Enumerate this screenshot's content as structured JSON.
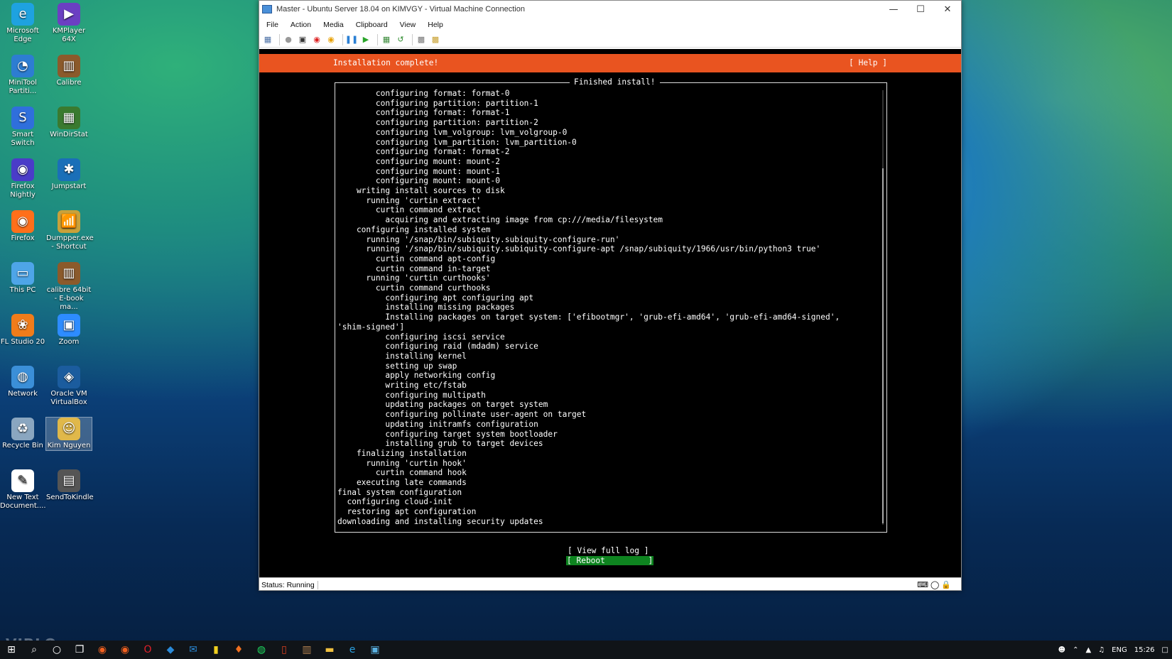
{
  "desktop": {
    "icons": [
      {
        "label": "Microsoft Edge",
        "icon": "edge-icon",
        "color": "#1ea2e0"
      },
      {
        "label": "KMPlayer 64X",
        "icon": "kmplayer-icon",
        "color": "#6b3fc2"
      },
      {
        "label": "MiniTool Partiti...",
        "icon": "minitool-icon",
        "color": "#2d7dd2"
      },
      {
        "label": "Calibre",
        "icon": "calibre-icon",
        "color": "#8b5a2b"
      },
      {
        "label": "Smart Switch",
        "icon": "smartswitch-icon",
        "color": "#2f6fdc"
      },
      {
        "label": "WinDirStat",
        "icon": "windirstat-icon",
        "color": "#3a7a2f"
      },
      {
        "label": "Firefox Nightly",
        "icon": "firefox-nightly-icon",
        "color": "#4a3cc8"
      },
      {
        "label": "Jumpstart",
        "icon": "jumpstart-icon",
        "color": "#1a6fb8"
      },
      {
        "label": "Firefox",
        "icon": "firefox-icon",
        "color": "#ff6f1a"
      },
      {
        "label": "Dumpper.exe - Shortcut",
        "icon": "dumpper-icon",
        "color": "#c9a13a"
      },
      {
        "label": "This PC",
        "icon": "this-pc-icon",
        "color": "#4ea5e8"
      },
      {
        "label": "calibre 64bit - E-book ma...",
        "icon": "calibre64-icon",
        "color": "#8b5a2b"
      },
      {
        "label": "FL Studio 20",
        "icon": "flstudio-icon",
        "color": "#f07c1a"
      },
      {
        "label": "Zoom",
        "icon": "zoom-icon",
        "color": "#2d8cff"
      },
      {
        "label": "Network",
        "icon": "network-icon",
        "color": "#3b8fd8"
      },
      {
        "label": "Oracle VM VirtualBox",
        "icon": "virtualbox-icon",
        "color": "#1b5c9e"
      },
      {
        "label": "Recycle Bin",
        "icon": "recycle-bin-icon",
        "color": "#8aa6c0"
      },
      {
        "label": "Kim Nguyen",
        "icon": "user-folder-icon",
        "color": "#e0b84a"
      },
      {
        "label": "New Text Document....",
        "icon": "text-doc-icon",
        "color": "#ffffff"
      },
      {
        "label": "SendToKindle",
        "icon": "kindle-icon",
        "color": "#555555"
      }
    ],
    "watermark": "VIBLO"
  },
  "window": {
    "title": "Master - Ubuntu Server 18.04 on KIMVGY - Virtual Machine Connection",
    "menu": [
      "File",
      "Action",
      "Media",
      "Clipboard",
      "View",
      "Help"
    ],
    "toolbar_icons": [
      "ctrl-alt-del-icon",
      "start-icon",
      "turnoff-icon",
      "shutdown-icon",
      "save-icon",
      "pause-icon",
      "resume-icon",
      "checkpoint-icon",
      "revert-icon",
      "enhanced-session-icon",
      "share-icon"
    ],
    "status": "Status: Running"
  },
  "installer": {
    "banner": "Installation complete!",
    "help": "[ Help ]",
    "box_title": "Finished install!",
    "log": [
      "        configuring format: format-0",
      "        configuring partition: partition-1",
      "        configuring format: format-1",
      "        configuring partition: partition-2",
      "        configuring lvm_volgroup: lvm_volgroup-0",
      "        configuring lvm_partition: lvm_partition-0",
      "        configuring format: format-2",
      "        configuring mount: mount-2",
      "        configuring mount: mount-1",
      "        configuring mount: mount-0",
      "    writing install sources to disk",
      "      running 'curtin extract'",
      "        curtin command extract",
      "          acquiring and extracting image from cp:///media/filesystem",
      "    configuring installed system",
      "      running '/snap/bin/subiquity.subiquity-configure-run'",
      "      running '/snap/bin/subiquity.subiquity-configure-apt /snap/subiquity/1966/usr/bin/python3 true'",
      "        curtin command apt-config",
      "        curtin command in-target",
      "      running 'curtin curthooks'",
      "        curtin command curthooks",
      "          configuring apt configuring apt",
      "          installing missing packages",
      "          Installing packages on target system: ['efibootmgr', 'grub-efi-amd64', 'grub-efi-amd64-signed',",
      "'shim-signed']",
      "          configuring iscsi service",
      "          configuring raid (mdadm) service",
      "          installing kernel",
      "          setting up swap",
      "          apply networking config",
      "          writing etc/fstab",
      "          configuring multipath",
      "          updating packages on target system",
      "          configuring pollinate user-agent on target",
      "          updating initramfs configuration",
      "          configuring target system bootloader",
      "          installing grub to target devices",
      "    finalizing installation",
      "      running 'curtin hook'",
      "        curtin command hook",
      "    executing late commands",
      "final system configuration",
      "  configuring cloud-init",
      "  restoring apt configuration",
      "downloading and installing security updates"
    ],
    "view_log": "[ View full log ]",
    "reboot": "[ Reboot         ]",
    "colors": {
      "banner": "#e95420",
      "reboot": "#0e8420"
    }
  },
  "taskbar": {
    "icons": [
      "start-icon",
      "search-icon",
      "cortana-icon",
      "task-view-icon",
      "app-orange-icon",
      "app-orange2-icon",
      "opera-icon",
      "vscode-icon",
      "mail-icon",
      "sticky-notes-icon",
      "app-fire-icon",
      "spotify-icon",
      "office-icon",
      "calibre-icon",
      "file-explorer-icon",
      "edge-icon",
      "hyperv-icon"
    ],
    "tray": {
      "lang": "ENG",
      "time": "15:26"
    }
  }
}
